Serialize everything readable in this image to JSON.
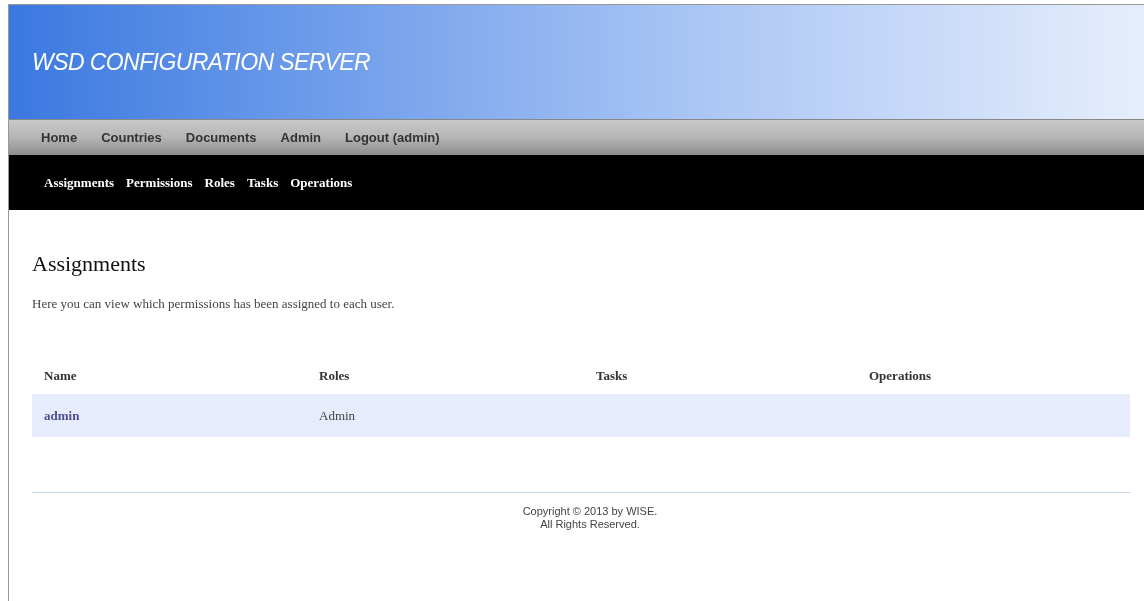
{
  "header": {
    "title": "WSD CONFIGURATION SERVER"
  },
  "main_menu": [
    "Home",
    "Countries",
    "Documents",
    "Admin",
    "Logout (admin)"
  ],
  "sub_menu": [
    "Assignments",
    "Permissions",
    "Roles",
    "Tasks",
    "Operations"
  ],
  "page": {
    "heading": "Assignments",
    "description": "Here you can view which permissions has been assigned to each user."
  },
  "table": {
    "columns": [
      "Name",
      "Roles",
      "Tasks",
      "Operations"
    ],
    "rows": [
      {
        "name": "admin",
        "roles": "Admin"
      }
    ]
  },
  "footer": [
    "Copyright © 2013 by WISE.",
    "All Rights Reserved."
  ]
}
